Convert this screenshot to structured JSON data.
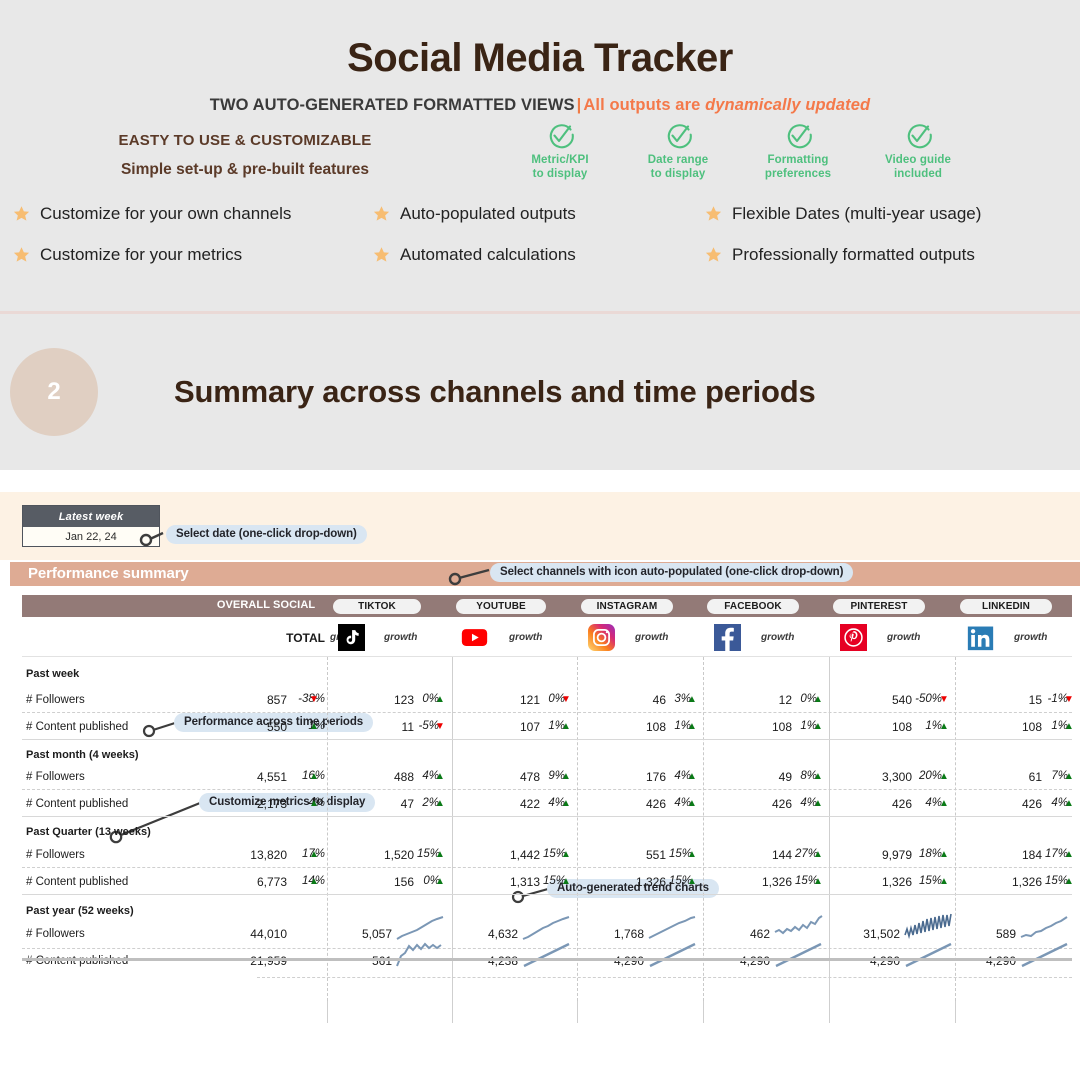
{
  "promo": {
    "title": "Social Media Tracker",
    "subtitle_dark": "TWO AUTO-GENERATED FORMATTED  VIEWS",
    "subtitle_pipe": "|",
    "subtitle_orange_plain": "All outputs are ",
    "subtitle_orange_italic": "dynamically updated",
    "easy_line1": "EASTY TO USE & CUSTOMIZABLE",
    "easy_line2": "Simple set-up & pre-built features",
    "checks": [
      {
        "line1": "Metric/KPI",
        "line2": "to display",
        "icon": "check-circle-icon"
      },
      {
        "line1": "Date range",
        "line2": "to display",
        "icon": "check-circle-icon"
      },
      {
        "line1": "Formatting",
        "line2": "preferences",
        "icon": "check-circle-icon"
      },
      {
        "line1": "Video guide",
        "line2": "included",
        "icon": "check-circle-icon"
      }
    ],
    "features": [
      "Customize for your own channels",
      "Auto-populated outputs",
      "Flexible Dates (multi-year usage)",
      "Customize for your metrics",
      "Automated calculations",
      "Professionally formatted outputs"
    ],
    "colors": {
      "background": "#e8e8e8",
      "title": "#3a2415",
      "orange": "#f4794a",
      "green": "#4ec07e",
      "star": "#f7bd72",
      "divider": "#ead9d6"
    }
  },
  "banner": {
    "number": "2",
    "title": "Summary across channels and time periods",
    "badge_color": "#e0cfc2",
    "title_color": "#3a2415"
  },
  "sheet": {
    "date_selector": {
      "label": "Latest week",
      "value": "Jan 22, 24"
    },
    "perf_title": "Performance summary",
    "callouts": [
      "Select date (one-click drop-down)",
      "Select channels with icon auto-populated (one-click drop-down)",
      "Performance across time periods",
      "Customize metrics to display",
      "Auto-generated trend charts"
    ],
    "colors": {
      "sheet_top": "#fdf2e4",
      "perf_bar": "#deab94",
      "table_header": "#937a77",
      "callout_bg": "#d9e6f2",
      "up": "#0a7a17",
      "down": "#ee0000",
      "spark": "#7b97b5"
    },
    "columns": [
      {
        "name": "OVERALL SOCIAL",
        "sub": "TOTAL",
        "growth_label": "growth",
        "icon": "",
        "is_overall": true
      },
      {
        "name": "TIKTOK",
        "sub": "",
        "growth_label": "growth",
        "icon": "tiktok-icon",
        "is_overall": false
      },
      {
        "name": "YOUTUBE",
        "sub": "",
        "growth_label": "growth",
        "icon": "youtube-icon",
        "is_overall": false
      },
      {
        "name": "INSTAGRAM",
        "sub": "",
        "growth_label": "growth",
        "icon": "instagram-icon",
        "is_overall": false
      },
      {
        "name": "FACEBOOK",
        "sub": "",
        "growth_label": "growth",
        "icon": "facebook-icon",
        "is_overall": false
      },
      {
        "name": "PINTEREST",
        "sub": "",
        "growth_label": "growth",
        "icon": "pinterest-icon",
        "is_overall": false
      },
      {
        "name": "LINKEDIN",
        "sub": "",
        "growth_label": "growth",
        "icon": "linkedin-icon",
        "is_overall": false
      }
    ],
    "sections": [
      {
        "label": "Past week",
        "has_growth": true,
        "rows": [
          {
            "metric": "# Followers",
            "cells": [
              {
                "value": "857",
                "pct": "-38%",
                "dir": "down"
              },
              {
                "value": "123",
                "pct": "0%",
                "dir": "up"
              },
              {
                "value": "121",
                "pct": "0%",
                "dir": "down"
              },
              {
                "value": "46",
                "pct": "3%",
                "dir": "up"
              },
              {
                "value": "12",
                "pct": "0%",
                "dir": "up"
              },
              {
                "value": "540",
                "pct": "-50%",
                "dir": "down"
              },
              {
                "value": "15",
                "pct": "-1%",
                "dir": "down"
              }
            ]
          },
          {
            "metric": "# Content published",
            "cells": [
              {
                "value": "550",
                "pct": "1%",
                "dir": "up"
              },
              {
                "value": "11",
                "pct": "-5%",
                "dir": "down"
              },
              {
                "value": "107",
                "pct": "1%",
                "dir": "up"
              },
              {
                "value": "108",
                "pct": "1%",
                "dir": "up"
              },
              {
                "value": "108",
                "pct": "1%",
                "dir": "up"
              },
              {
                "value": "108",
                "pct": "1%",
                "dir": "up"
              },
              {
                "value": "108",
                "pct": "1%",
                "dir": "up"
              }
            ]
          }
        ]
      },
      {
        "label": "Past month (4 weeks)",
        "has_growth": true,
        "rows": [
          {
            "metric": "# Followers",
            "cells": [
              {
                "value": "4,551",
                "pct": "16%",
                "dir": "up"
              },
              {
                "value": "488",
                "pct": "4%",
                "dir": "up"
              },
              {
                "value": "478",
                "pct": "9%",
                "dir": "up"
              },
              {
                "value": "176",
                "pct": "4%",
                "dir": "up"
              },
              {
                "value": "49",
                "pct": "8%",
                "dir": "up"
              },
              {
                "value": "3,300",
                "pct": "20%",
                "dir": "up"
              },
              {
                "value": "61",
                "pct": "7%",
                "dir": "up"
              }
            ]
          },
          {
            "metric": "# Content published",
            "cells": [
              {
                "value": "2,173",
                "pct": "4%",
                "dir": "up"
              },
              {
                "value": "47",
                "pct": "2%",
                "dir": "up"
              },
              {
                "value": "422",
                "pct": "4%",
                "dir": "up"
              },
              {
                "value": "426",
                "pct": "4%",
                "dir": "up"
              },
              {
                "value": "426",
                "pct": "4%",
                "dir": "up"
              },
              {
                "value": "426",
                "pct": "4%",
                "dir": "up"
              },
              {
                "value": "426",
                "pct": "4%",
                "dir": "up"
              }
            ]
          }
        ]
      },
      {
        "label": "Past Quarter (13 weeks)",
        "has_growth": true,
        "rows": [
          {
            "metric": "# Followers",
            "cells": [
              {
                "value": "13,820",
                "pct": "17%",
                "dir": "up"
              },
              {
                "value": "1,520",
                "pct": "15%",
                "dir": "up"
              },
              {
                "value": "1,442",
                "pct": "15%",
                "dir": "up"
              },
              {
                "value": "551",
                "pct": "15%",
                "dir": "up"
              },
              {
                "value": "144",
                "pct": "27%",
                "dir": "up"
              },
              {
                "value": "9,979",
                "pct": "18%",
                "dir": "up"
              },
              {
                "value": "184",
                "pct": "17%",
                "dir": "up"
              }
            ]
          },
          {
            "metric": "# Content published",
            "cells": [
              {
                "value": "6,773",
                "pct": "14%",
                "dir": "up"
              },
              {
                "value": "156",
                "pct": "0%",
                "dir": "up"
              },
              {
                "value": "1,313",
                "pct": "15%",
                "dir": "up"
              },
              {
                "value": "1,326",
                "pct": "15%",
                "dir": "up"
              },
              {
                "value": "1,326",
                "pct": "15%",
                "dir": "up"
              },
              {
                "value": "1,326",
                "pct": "15%",
                "dir": "up"
              },
              {
                "value": "1,326",
                "pct": "15%",
                "dir": "up"
              }
            ]
          }
        ]
      },
      {
        "label": "Past year (52 weeks)",
        "has_growth": false,
        "rows": [
          {
            "metric": "# Followers",
            "cells": [
              {
                "value": "44,010",
                "spark": "none"
              },
              {
                "value": "5,057",
                "spark": "rising"
              },
              {
                "value": "4,632",
                "spark": "rising"
              },
              {
                "value": "1,768",
                "spark": "rising"
              },
              {
                "value": "462",
                "spark": "jagged-rise"
              },
              {
                "value": "31,502",
                "spark": "volatile"
              },
              {
                "value": "589",
                "spark": "rising-wobble"
              }
            ]
          },
          {
            "metric": "# Content published",
            "cells": [
              {
                "value": "21,959",
                "spark": "none"
              },
              {
                "value": "561",
                "spark": "spiky"
              },
              {
                "value": "4,238",
                "spark": "steep"
              },
              {
                "value": "4,290",
                "spark": "steep"
              },
              {
                "value": "4,290",
                "spark": "steep"
              },
              {
                "value": "4,290",
                "spark": "steep"
              },
              {
                "value": "4,290",
                "spark": "steep"
              }
            ]
          }
        ]
      }
    ]
  }
}
